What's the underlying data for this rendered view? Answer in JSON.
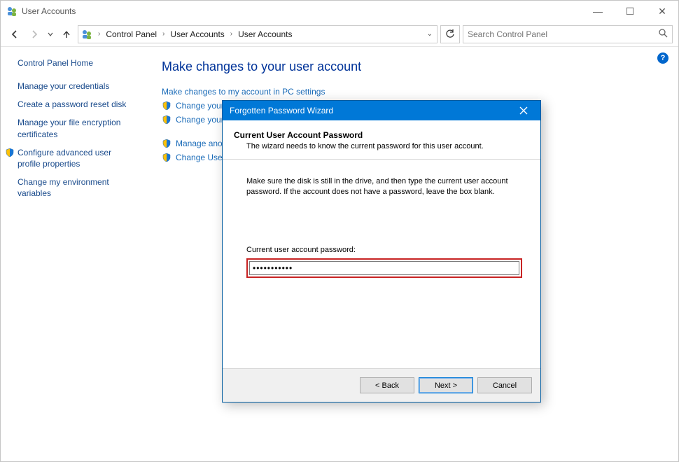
{
  "window": {
    "title": "User Accounts",
    "controls": {
      "minimize": "—",
      "maximize": "☐",
      "close": "✕"
    }
  },
  "nav": {
    "breadcrumb": [
      "Control Panel",
      "User Accounts",
      "User Accounts"
    ],
    "refresh_tooltip": "Refresh",
    "search": {
      "placeholder": "Search Control Panel"
    }
  },
  "sidebar": {
    "home": "Control Panel Home",
    "links": [
      "Manage your credentials",
      "Create a password reset disk",
      "Manage your file encryption certificates",
      "Configure advanced user profile properties",
      "Change my environment variables"
    ],
    "shielded_index": 3
  },
  "main": {
    "heading": "Make changes to your user account",
    "group1": [
      {
        "label": "Make changes to my account in PC settings",
        "shield": false
      },
      {
        "label": "Change your account name",
        "shield": true
      },
      {
        "label": "Change your account type",
        "shield": true
      }
    ],
    "group2": [
      {
        "label": "Manage another account",
        "shield": true
      },
      {
        "label": "Change User Account Control settings",
        "shield": true
      }
    ]
  },
  "wizard": {
    "title": "Forgotten Password Wizard",
    "heading": "Current User Account Password",
    "subheading": "The wizard needs to know the current password for this user account.",
    "instruction": "Make sure the disk is still in the drive, and then type the current user account password. If the account does not have a password, leave the box blank.",
    "password_label": "Current user account password:",
    "password_value": "•••••••••••",
    "buttons": {
      "back": "< Back",
      "next": "Next >",
      "cancel": "Cancel"
    }
  },
  "help_badge": "?"
}
